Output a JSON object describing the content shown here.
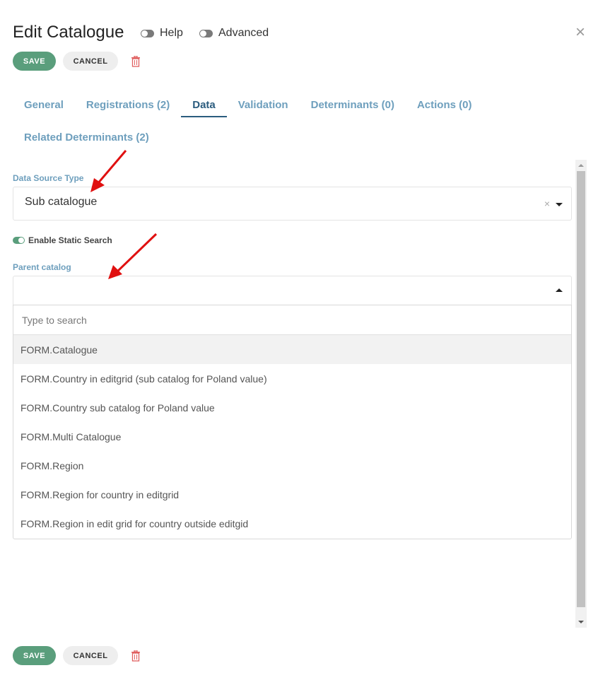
{
  "dialog": {
    "title": "Edit Catalogue",
    "help_label": "Help",
    "advanced_label": "Advanced",
    "close_icon": "×"
  },
  "toolbar": {
    "save_label": "SAVE",
    "cancel_label": "CANCEL"
  },
  "tabs": [
    {
      "label": "General"
    },
    {
      "label": "Registrations (2)"
    },
    {
      "label": "Data"
    },
    {
      "label": "Validation"
    },
    {
      "label": "Determinants (0)"
    },
    {
      "label": "Actions (0)"
    },
    {
      "label": "Related Determinants (2)"
    }
  ],
  "data_source": {
    "label": "Data Source Type",
    "value": "Sub catalogue",
    "clear_glyph": "×"
  },
  "static_search": {
    "label": "Enable Static Search"
  },
  "parent_catalog": {
    "label": "Parent catalog",
    "search_placeholder": "Type to search",
    "options": [
      "FORM.Catalogue",
      "FORM.Country in editgrid (sub catalog for Poland value)",
      "FORM.Country sub catalog for Poland value",
      "FORM.Multi Catalogue",
      "FORM.Region",
      "FORM.Region for country in editgrid",
      "FORM.Region in edit grid for country outside editgid"
    ]
  },
  "colors": {
    "accent": "#5a9e7c",
    "tab_text": "#6e9fbd",
    "tab_active": "#2b5c7e",
    "delete": "#e06060",
    "annotation_arrow": "#e01010"
  }
}
